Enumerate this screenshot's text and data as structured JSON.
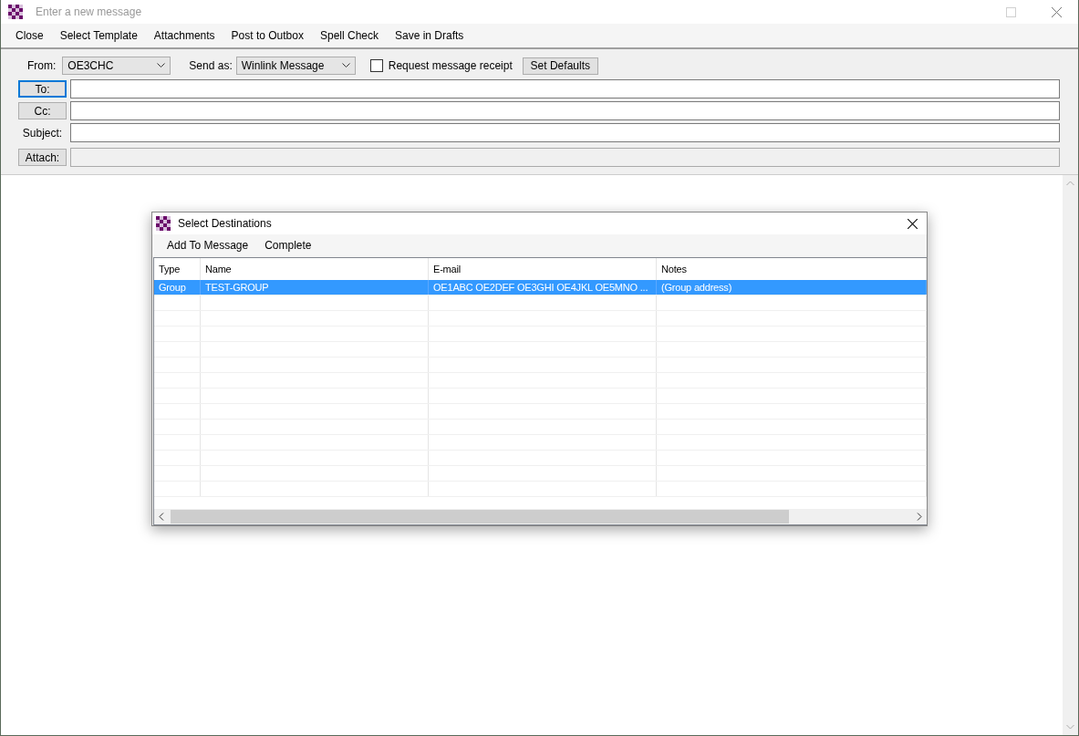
{
  "window": {
    "title": "Enter a new message"
  },
  "menu": [
    "Close",
    "Select Template",
    "Attachments",
    "Post to Outbox",
    "Spell Check",
    "Save in Drafts"
  ],
  "header": {
    "from_label": "From:",
    "from_value": "OE3CHC",
    "send_as_label": "Send as:",
    "send_as_value": "Winlink Message",
    "receipt": {
      "label": "Request message receipt",
      "checked": false
    },
    "set_defaults": "Set Defaults",
    "fields": [
      {
        "kind": "button",
        "label": "To:",
        "focused": true
      },
      {
        "kind": "button",
        "label": "Cc:",
        "focused": false
      },
      {
        "kind": "label",
        "label": "Subject:"
      },
      {
        "kind": "attach",
        "label": "Attach:",
        "focused": false
      }
    ]
  },
  "dialog": {
    "title": "Select Destinations",
    "menu": [
      "Add To Message",
      "Complete"
    ],
    "table": {
      "columns": [
        "Type",
        "Name",
        "E-mail",
        "Notes"
      ],
      "rows": [
        {
          "cells": [
            "Group",
            "TEST-GROUP",
            "OE1ABC OE2DEF OE3GHI OE4JKL OE5MNO ...",
            "(Group address)"
          ],
          "selected": true
        }
      ]
    }
  }
}
